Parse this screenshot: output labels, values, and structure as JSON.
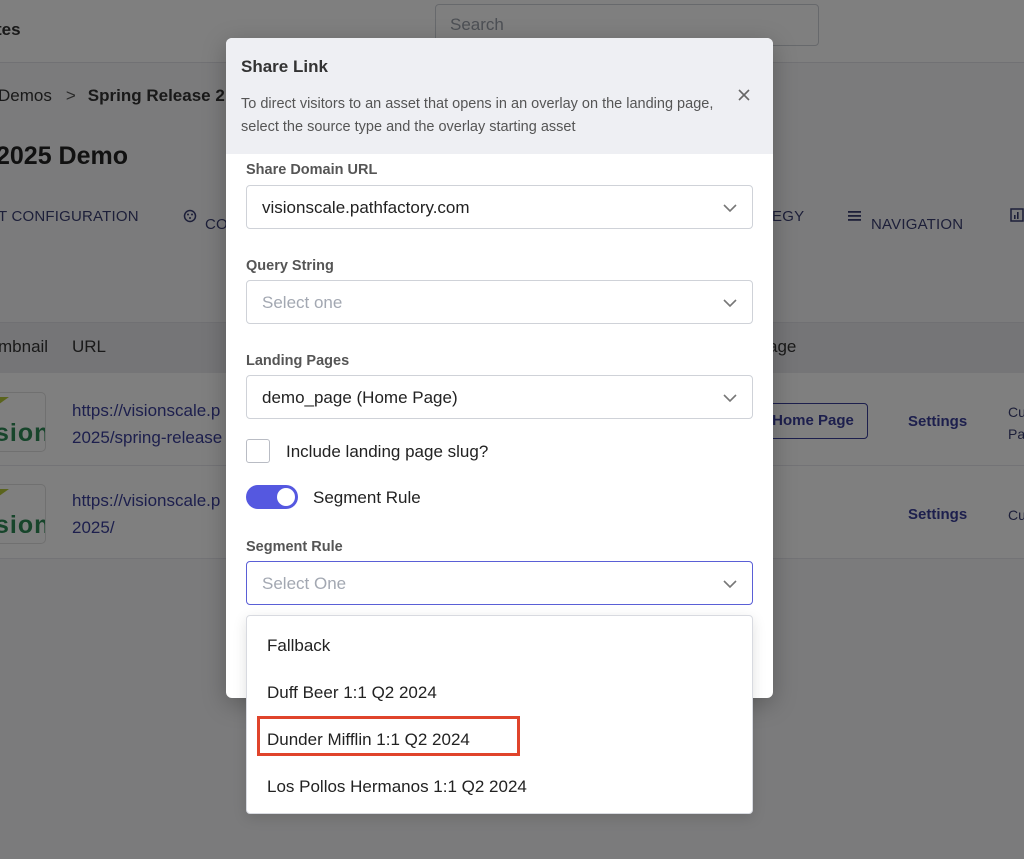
{
  "background": {
    "app_title": "tes",
    "search": {
      "placeholder": "Search"
    },
    "breadcrumb": {
      "parent": "Demos",
      "separator": ">",
      "current": "Spring Release 2"
    },
    "page_title": "2025 Demo",
    "tabs": [
      "T CONFIGURATION",
      "CO",
      "EGY",
      "NAVIGATION"
    ],
    "table": {
      "headers": [
        "mbnail",
        "URL",
        "age"
      ],
      "rows": [
        {
          "thumb_text": "sion",
          "url_line1": "https://visionscale.p",
          "url_line2": "2025/spring-release",
          "button": "Home Page",
          "settings": "Settings",
          "extra_line1": "Cu",
          "extra_line2": "Pa"
        },
        {
          "thumb_text": "sion",
          "url_line1": "https://visionscale.p",
          "url_line2": "2025/",
          "settings": "Settings",
          "extra_line1": "Cu"
        }
      ]
    }
  },
  "modal": {
    "title": "Share Link",
    "description": "To direct visitors to an asset that opens in an overlay on the landing page, select the source type and the overlay starting asset",
    "fields": {
      "share_domain": {
        "label": "Share Domain URL",
        "value": "visionscale.pathfactory.com"
      },
      "query_string": {
        "label": "Query String",
        "placeholder": "Select one"
      },
      "landing_pages": {
        "label": "Landing Pages",
        "value": "demo_page (Home Page)"
      },
      "include_slug": {
        "label": "Include landing page slug?",
        "checked": false
      },
      "segment_toggle": {
        "label": "Segment Rule",
        "on": true
      },
      "segment_rule": {
        "label": "Segment Rule",
        "placeholder": "Select One"
      }
    }
  },
  "dropdown": {
    "options": [
      "Fallback",
      "Duff Beer 1:1 Q2 2024",
      "Dunder Mifflin 1:1 Q2 2024",
      "Los Pollos Hermanos 1:1 Q2 2024"
    ],
    "highlighted_index": 2
  },
  "colors": {
    "accent": "#5558e0",
    "highlight": "#e0442b",
    "link": "#3a3f9a"
  }
}
